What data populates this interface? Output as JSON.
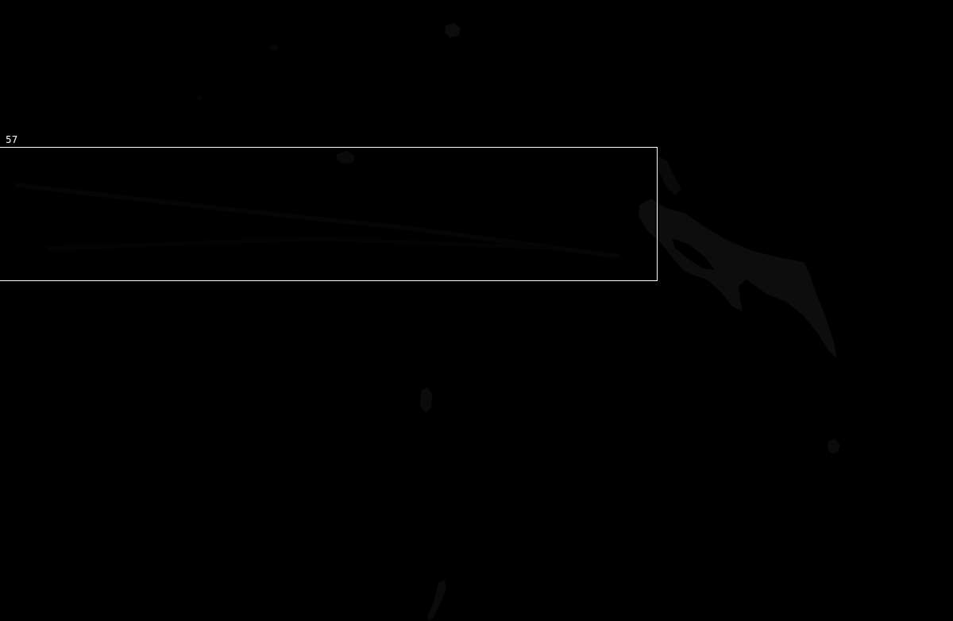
{
  "annotation": {
    "label": "57",
    "box_color": "#ffffff",
    "label_color": "#ffffff"
  },
  "image": {
    "background_color": "#000000",
    "feature_color": "#0d0d0d"
  }
}
